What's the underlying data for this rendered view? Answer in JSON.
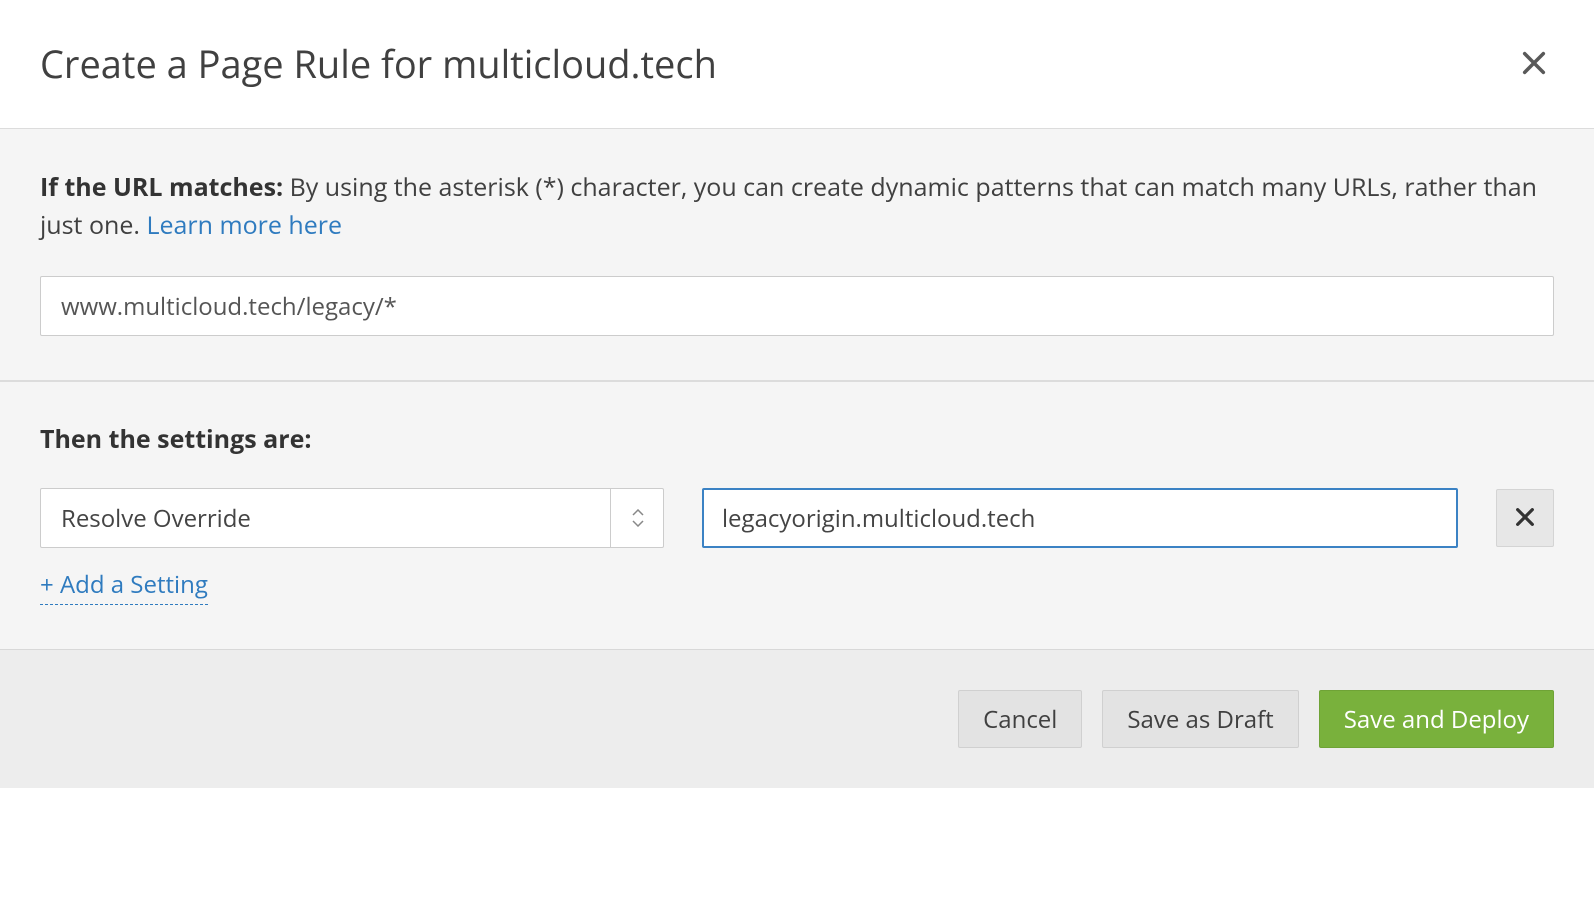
{
  "header": {
    "title": "Create a Page Rule for multicloud.tech"
  },
  "urlSection": {
    "labelBold": "If the URL matches:",
    "labelText": " By using the asterisk (*) character, you can create dynamic patterns that can match many URLs, rather than just one. ",
    "linkText": "Learn more here",
    "inputValue": "www.multicloud.tech/legacy/*"
  },
  "settingsSection": {
    "heading": "Then the settings are:",
    "settingSelected": "Resolve Override",
    "settingValue": "legacyorigin.multicloud.tech",
    "addLink": "+ Add a Setting"
  },
  "footer": {
    "cancel": "Cancel",
    "saveDraft": "Save as Draft",
    "saveDeploy": "Save and Deploy"
  }
}
